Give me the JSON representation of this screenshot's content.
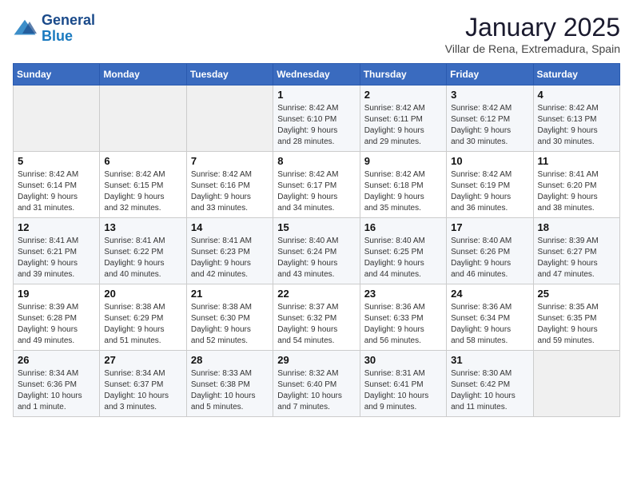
{
  "header": {
    "logo_general": "General",
    "logo_blue": "Blue",
    "month_title": "January 2025",
    "location": "Villar de Rena, Extremadura, Spain"
  },
  "weekdays": [
    "Sunday",
    "Monday",
    "Tuesday",
    "Wednesday",
    "Thursday",
    "Friday",
    "Saturday"
  ],
  "weeks": [
    [
      {
        "day": "",
        "detail": ""
      },
      {
        "day": "",
        "detail": ""
      },
      {
        "day": "",
        "detail": ""
      },
      {
        "day": "1",
        "detail": "Sunrise: 8:42 AM\nSunset: 6:10 PM\nDaylight: 9 hours\nand 28 minutes."
      },
      {
        "day": "2",
        "detail": "Sunrise: 8:42 AM\nSunset: 6:11 PM\nDaylight: 9 hours\nand 29 minutes."
      },
      {
        "day": "3",
        "detail": "Sunrise: 8:42 AM\nSunset: 6:12 PM\nDaylight: 9 hours\nand 30 minutes."
      },
      {
        "day": "4",
        "detail": "Sunrise: 8:42 AM\nSunset: 6:13 PM\nDaylight: 9 hours\nand 30 minutes."
      }
    ],
    [
      {
        "day": "5",
        "detail": "Sunrise: 8:42 AM\nSunset: 6:14 PM\nDaylight: 9 hours\nand 31 minutes."
      },
      {
        "day": "6",
        "detail": "Sunrise: 8:42 AM\nSunset: 6:15 PM\nDaylight: 9 hours\nand 32 minutes."
      },
      {
        "day": "7",
        "detail": "Sunrise: 8:42 AM\nSunset: 6:16 PM\nDaylight: 9 hours\nand 33 minutes."
      },
      {
        "day": "8",
        "detail": "Sunrise: 8:42 AM\nSunset: 6:17 PM\nDaylight: 9 hours\nand 34 minutes."
      },
      {
        "day": "9",
        "detail": "Sunrise: 8:42 AM\nSunset: 6:18 PM\nDaylight: 9 hours\nand 35 minutes."
      },
      {
        "day": "10",
        "detail": "Sunrise: 8:42 AM\nSunset: 6:19 PM\nDaylight: 9 hours\nand 36 minutes."
      },
      {
        "day": "11",
        "detail": "Sunrise: 8:41 AM\nSunset: 6:20 PM\nDaylight: 9 hours\nand 38 minutes."
      }
    ],
    [
      {
        "day": "12",
        "detail": "Sunrise: 8:41 AM\nSunset: 6:21 PM\nDaylight: 9 hours\nand 39 minutes."
      },
      {
        "day": "13",
        "detail": "Sunrise: 8:41 AM\nSunset: 6:22 PM\nDaylight: 9 hours\nand 40 minutes."
      },
      {
        "day": "14",
        "detail": "Sunrise: 8:41 AM\nSunset: 6:23 PM\nDaylight: 9 hours\nand 42 minutes."
      },
      {
        "day": "15",
        "detail": "Sunrise: 8:40 AM\nSunset: 6:24 PM\nDaylight: 9 hours\nand 43 minutes."
      },
      {
        "day": "16",
        "detail": "Sunrise: 8:40 AM\nSunset: 6:25 PM\nDaylight: 9 hours\nand 44 minutes."
      },
      {
        "day": "17",
        "detail": "Sunrise: 8:40 AM\nSunset: 6:26 PM\nDaylight: 9 hours\nand 46 minutes."
      },
      {
        "day": "18",
        "detail": "Sunrise: 8:39 AM\nSunset: 6:27 PM\nDaylight: 9 hours\nand 47 minutes."
      }
    ],
    [
      {
        "day": "19",
        "detail": "Sunrise: 8:39 AM\nSunset: 6:28 PM\nDaylight: 9 hours\nand 49 minutes."
      },
      {
        "day": "20",
        "detail": "Sunrise: 8:38 AM\nSunset: 6:29 PM\nDaylight: 9 hours\nand 51 minutes."
      },
      {
        "day": "21",
        "detail": "Sunrise: 8:38 AM\nSunset: 6:30 PM\nDaylight: 9 hours\nand 52 minutes."
      },
      {
        "day": "22",
        "detail": "Sunrise: 8:37 AM\nSunset: 6:32 PM\nDaylight: 9 hours\nand 54 minutes."
      },
      {
        "day": "23",
        "detail": "Sunrise: 8:36 AM\nSunset: 6:33 PM\nDaylight: 9 hours\nand 56 minutes."
      },
      {
        "day": "24",
        "detail": "Sunrise: 8:36 AM\nSunset: 6:34 PM\nDaylight: 9 hours\nand 58 minutes."
      },
      {
        "day": "25",
        "detail": "Sunrise: 8:35 AM\nSunset: 6:35 PM\nDaylight: 9 hours\nand 59 minutes."
      }
    ],
    [
      {
        "day": "26",
        "detail": "Sunrise: 8:34 AM\nSunset: 6:36 PM\nDaylight: 10 hours\nand 1 minute."
      },
      {
        "day": "27",
        "detail": "Sunrise: 8:34 AM\nSunset: 6:37 PM\nDaylight: 10 hours\nand 3 minutes."
      },
      {
        "day": "28",
        "detail": "Sunrise: 8:33 AM\nSunset: 6:38 PM\nDaylight: 10 hours\nand 5 minutes."
      },
      {
        "day": "29",
        "detail": "Sunrise: 8:32 AM\nSunset: 6:40 PM\nDaylight: 10 hours\nand 7 minutes."
      },
      {
        "day": "30",
        "detail": "Sunrise: 8:31 AM\nSunset: 6:41 PM\nDaylight: 10 hours\nand 9 minutes."
      },
      {
        "day": "31",
        "detail": "Sunrise: 8:30 AM\nSunset: 6:42 PM\nDaylight: 10 hours\nand 11 minutes."
      },
      {
        "day": "",
        "detail": ""
      }
    ]
  ]
}
